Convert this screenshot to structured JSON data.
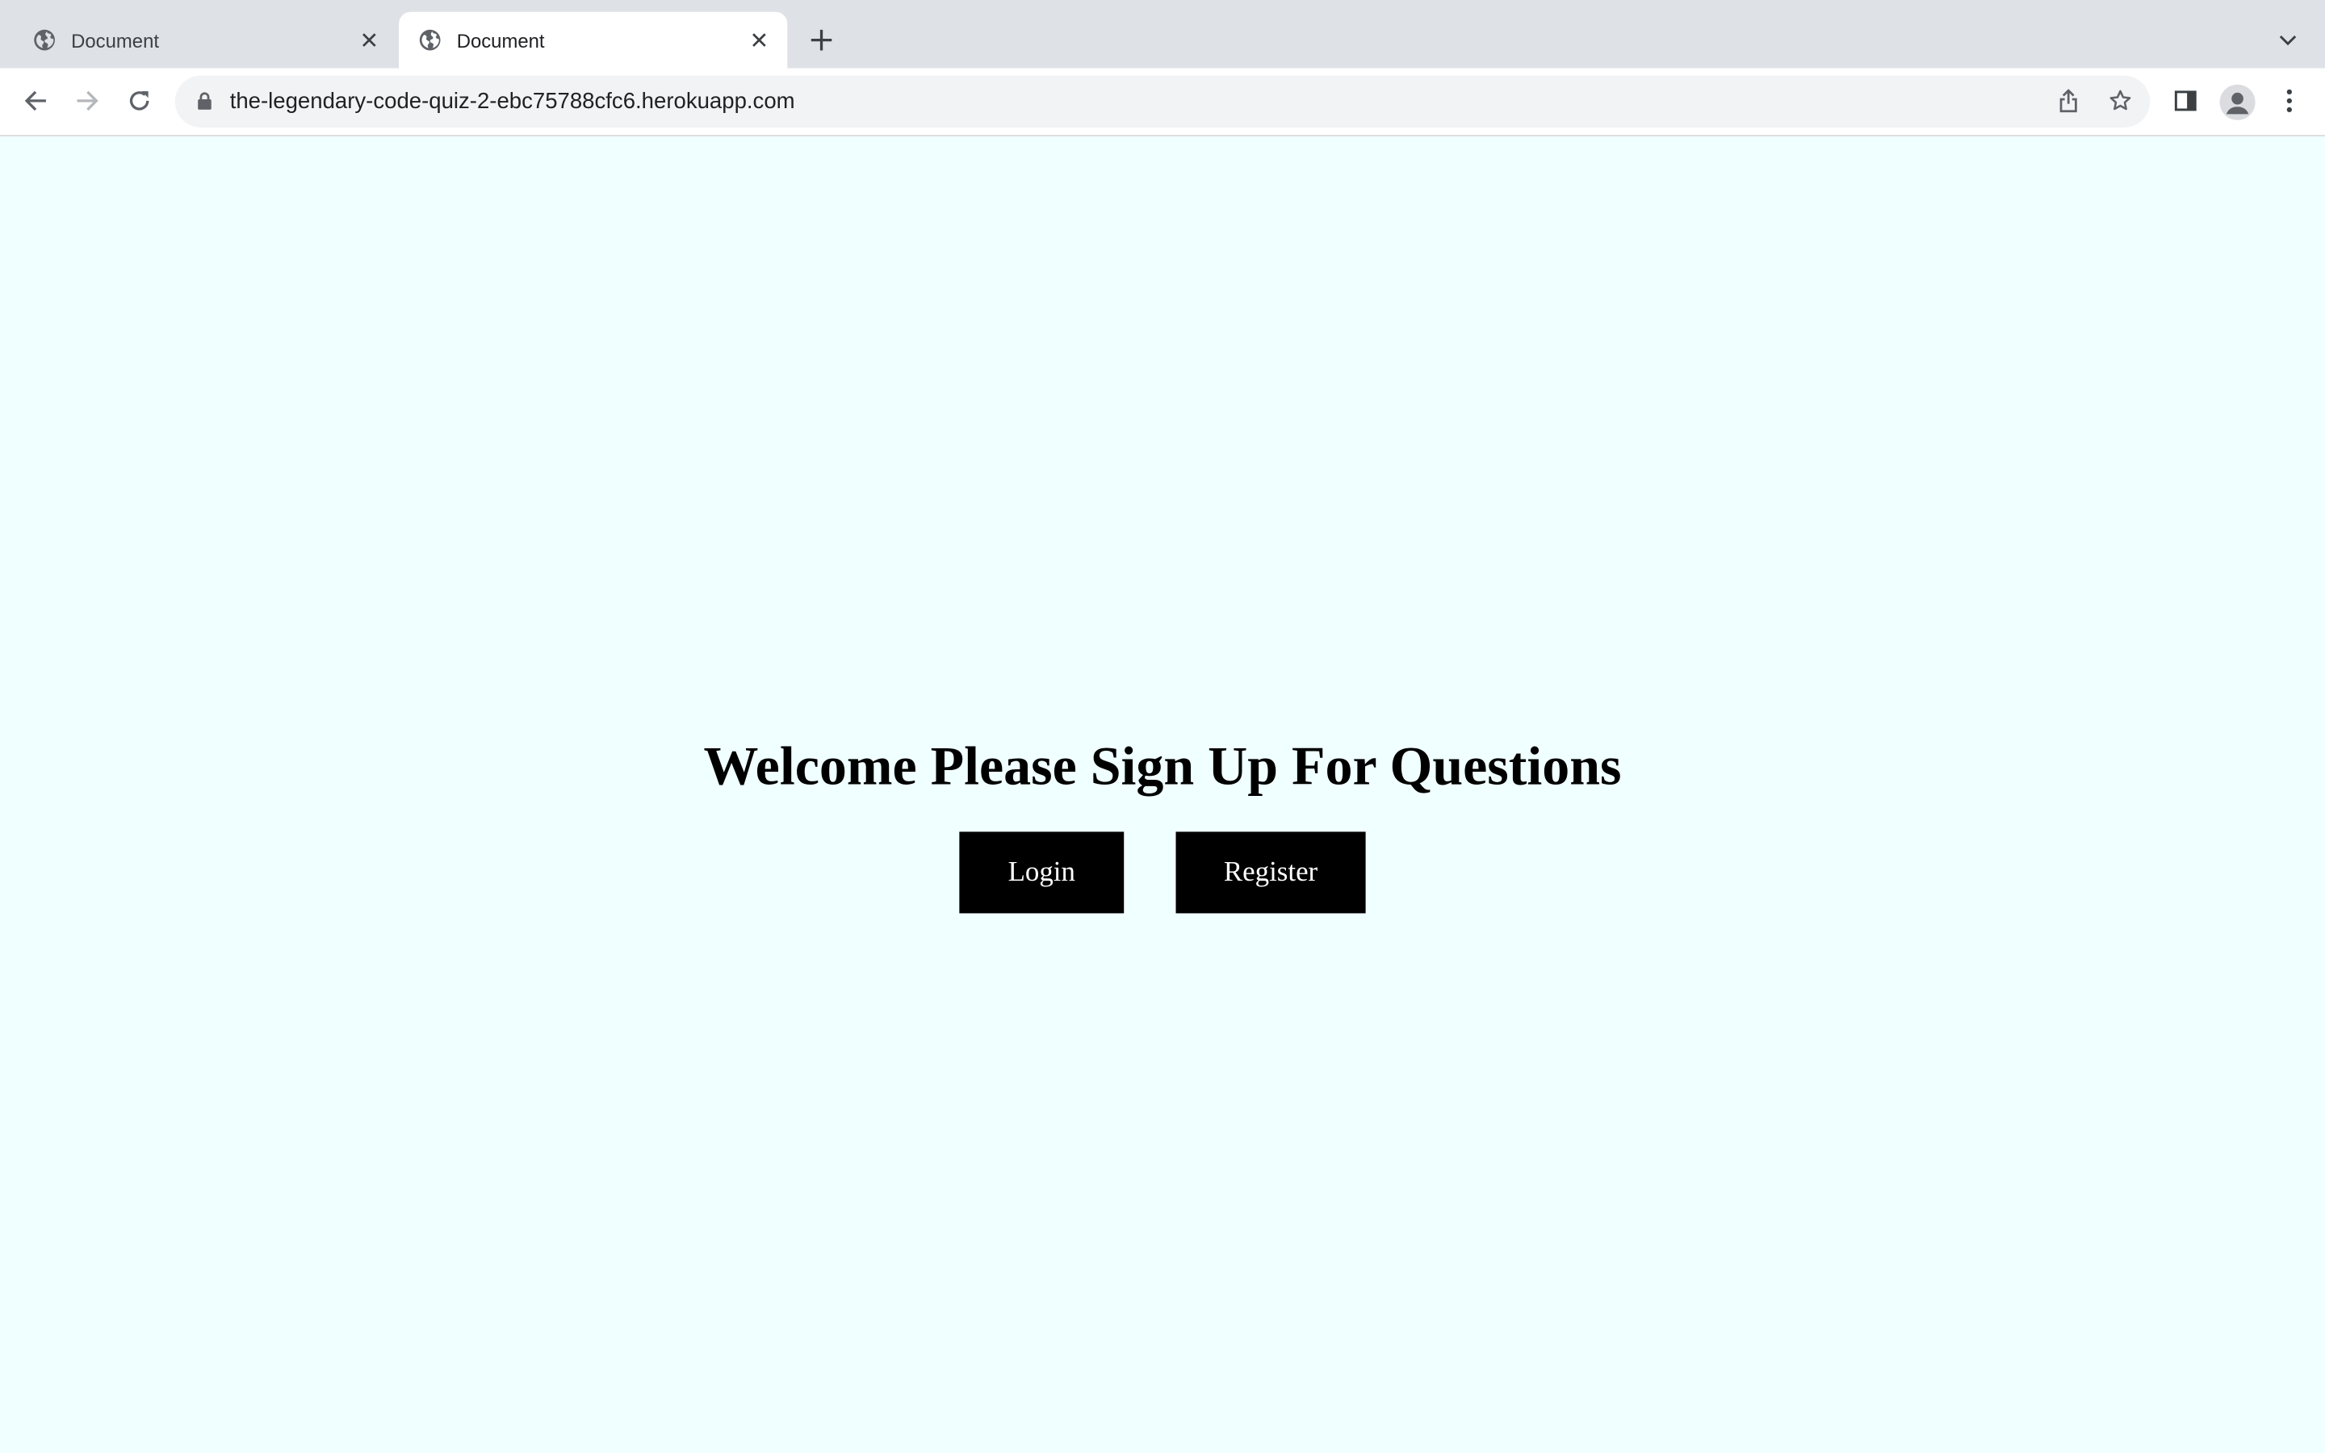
{
  "browser": {
    "tabs": [
      {
        "title": "Document",
        "active": false,
        "icon": "globe-icon"
      },
      {
        "title": "Document",
        "active": true,
        "icon": "globe-icon"
      }
    ],
    "address_bar": {
      "url": "the-legendary-code-quiz-2-ebc75788cfc6.herokuapp.com"
    }
  },
  "page": {
    "background_color": "#f0ffff",
    "heading": "Welcome Please Sign Up For Questions",
    "buttons": {
      "login_label": "Login",
      "register_label": "Register"
    }
  }
}
